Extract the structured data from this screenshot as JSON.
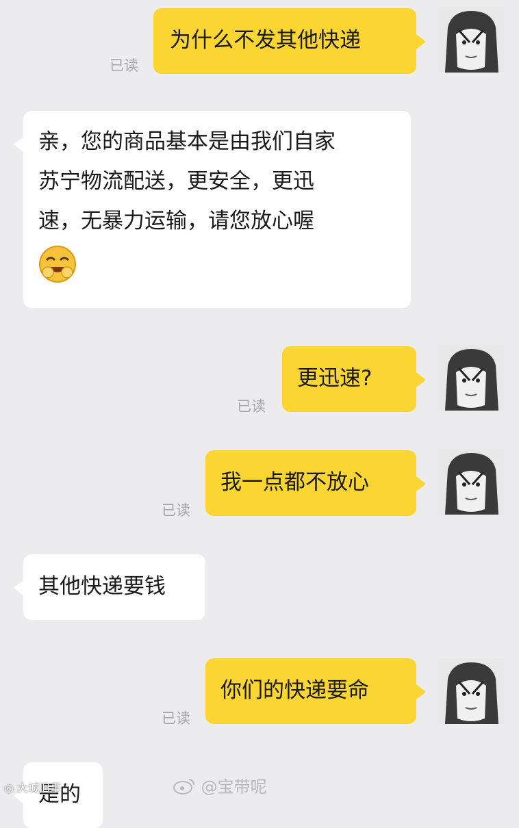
{
  "chat": {
    "messages": [
      {
        "side": "me",
        "text": "为什么不发其他快递",
        "status": "已读"
      },
      {
        "side": "them",
        "lines": [
          "亲，您的商品基本是由我们自家",
          "苏宁物流配送，更安全，更迅",
          "速，无暴力运输，请您放心喔"
        ],
        "emoji": "laughing-emoji"
      },
      {
        "side": "me",
        "text": "更迅速?",
        "status": "已读"
      },
      {
        "side": "me",
        "text": "我一点都不放心",
        "status": "已读"
      },
      {
        "side": "them",
        "text": "其他快递要钱"
      },
      {
        "side": "me",
        "text": "你们的快递要命",
        "status": "已读"
      },
      {
        "side": "them",
        "text": "是的"
      }
    ]
  },
  "watermark": {
    "text": "@宝带呢"
  },
  "corner": {
    "text": "大城旧事"
  },
  "colors": {
    "me_bubble": "#fbd532",
    "them_bubble": "#ffffff",
    "background": "#ececef"
  }
}
